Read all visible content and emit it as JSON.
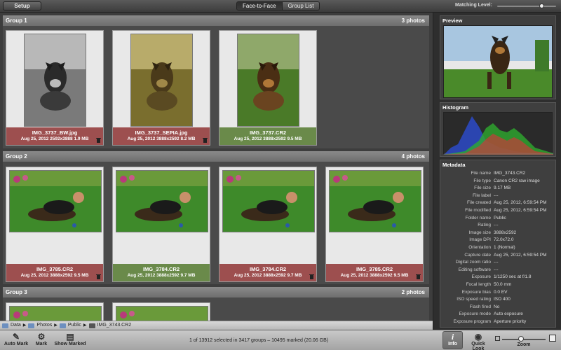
{
  "toolbar": {
    "setup_label": "Setup",
    "modes": [
      "Face-to-Face",
      "Group List"
    ],
    "matching_label": "Matching Level:",
    "matching_level": 0.8
  },
  "groups": [
    {
      "title": "Group 1",
      "count": "3 photos",
      "items": [
        {
          "name": "IMG_3737_BW.jpg",
          "meta": "Aug 25, 2012  2592x3888  1.9 MB",
          "status": "red",
          "trash": true
        },
        {
          "name": "IMG_3737_SEPIA.jpg",
          "meta": "Aug 25, 2012  3888x2592  8.2 MB",
          "status": "red",
          "trash": true
        },
        {
          "name": "IMG_3737.CR2",
          "meta": "Aug 25, 2012  3888x2592  9.5 MB",
          "status": "green",
          "trash": false
        }
      ]
    },
    {
      "title": "Group 2",
      "count": "4 photos",
      "items": [
        {
          "name": "IMG_3785.CR2",
          "meta": "Aug 25, 2012  3888x2592  9.5 MB",
          "status": "red",
          "trash": true
        },
        {
          "name": "IMG_3784.CR2",
          "meta": "Aug 25, 2012  3888x2592  9.7 MB",
          "status": "green",
          "trash": false
        },
        {
          "name": "IMG_3784.CR2",
          "meta": "Aug 25, 2012  3888x2592  9.7 MB",
          "status": "red",
          "trash": true
        },
        {
          "name": "IMG_3785.CR2",
          "meta": "Aug 25, 2012  3888x2592  9.5 MB",
          "status": "red",
          "trash": true
        }
      ]
    },
    {
      "title": "Group 3",
      "count": "2 photos",
      "items": []
    }
  ],
  "pathbar": [
    "Data",
    "Photos",
    "Public",
    "IMG_3743.CR2"
  ],
  "sidebar": {
    "preview_title": "Preview",
    "histogram_title": "Histogram",
    "metadata_title": "Metadata",
    "metadata": [
      {
        "k": "File name",
        "v": "IMG_3743.CR2"
      },
      {
        "k": "File type",
        "v": "Canon CR2 raw image"
      },
      {
        "k": "File size",
        "v": "9.17 MB"
      },
      {
        "k": "File label",
        "v": "---"
      },
      {
        "k": "File created",
        "v": "Aug 25, 2012, 6:59:54 PM"
      },
      {
        "k": "File modified",
        "v": "Aug 25, 2012, 6:59:54 PM"
      },
      {
        "k": "Folder name",
        "v": "Public"
      },
      {
        "k": "Rating",
        "v": "---"
      },
      {
        "k": "Image size",
        "v": "3888x2592"
      },
      {
        "k": "Image DPI",
        "v": "72.0x72.0"
      },
      {
        "k": "Orientation",
        "v": "1 (Normal)"
      },
      {
        "k": "Capture date",
        "v": "Aug 25, 2012, 6:59:54 PM"
      },
      {
        "k": "Digital zoom ratio",
        "v": "---"
      },
      {
        "k": "Editing software",
        "v": "---"
      },
      {
        "k": "Exposure",
        "v": "1/1250 sec at f/1.8"
      },
      {
        "k": "Focal length",
        "v": "50.0 mm"
      },
      {
        "k": "Exposure bias",
        "v": "0.0 EV"
      },
      {
        "k": "ISO speed rating",
        "v": "ISO 400"
      },
      {
        "k": "Flash fired",
        "v": "No"
      },
      {
        "k": "Exposure mode",
        "v": "Auto exposure"
      },
      {
        "k": "Exposure program",
        "v": "Aperture priority"
      }
    ]
  },
  "bottombar": {
    "auto_mark": "Auto Mark",
    "mark": "Mark",
    "show_marked": "Show Marked",
    "status": "1 of 13912 selected in 3417 groups – 10495 marked (20.06 GB)",
    "info": "Info",
    "quick_look": "Quick Look",
    "zoom": "Zoom",
    "zoom_level": 0.4
  },
  "colors": {
    "marked": "#9d4f4f",
    "kept": "#6a8a4a"
  }
}
